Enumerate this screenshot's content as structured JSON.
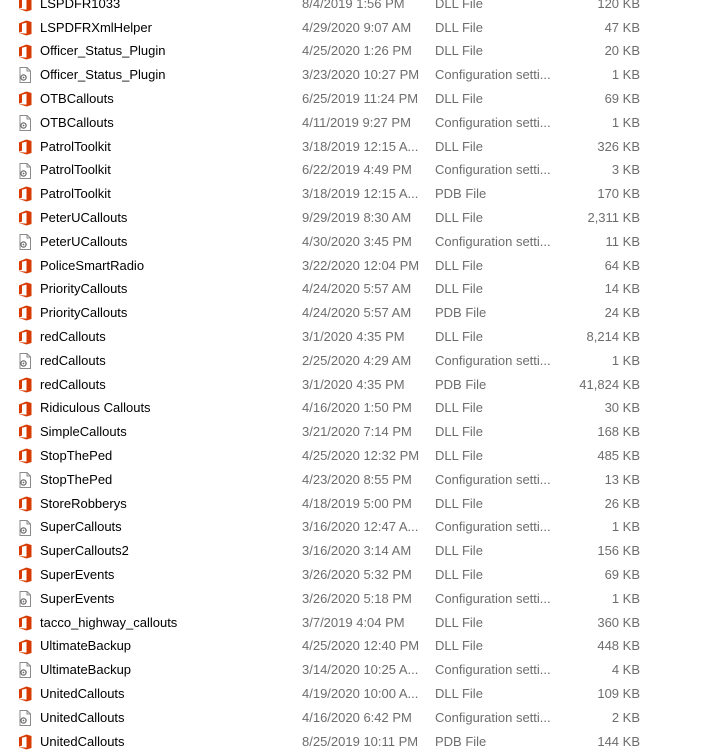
{
  "colors": {
    "office_icon": "#d83b01",
    "config_icon": "#8a8a8a",
    "meta_text": "#6d6d6d"
  },
  "files": [
    {
      "name": "LSPDFR1033",
      "date": "8/4/2019 1:56 PM",
      "type": "DLL File",
      "size": "120 KB",
      "icon": "office-icon"
    },
    {
      "name": "LSPDFRXmlHelper",
      "date": "4/29/2020 9:07 AM",
      "type": "DLL File",
      "size": "47 KB",
      "icon": "office-icon"
    },
    {
      "name": "Officer_Status_Plugin",
      "date": "4/25/2020 1:26 PM",
      "type": "DLL File",
      "size": "20 KB",
      "icon": "office-icon"
    },
    {
      "name": "Officer_Status_Plugin",
      "date": "3/23/2020 10:27 PM",
      "type": "Configuration setti...",
      "size": "1 KB",
      "icon": "config-file-icon"
    },
    {
      "name": "OTBCallouts",
      "date": "6/25/2019 11:24 PM",
      "type": "DLL File",
      "size": "69 KB",
      "icon": "office-icon"
    },
    {
      "name": "OTBCallouts",
      "date": "4/11/2019 9:27 PM",
      "type": "Configuration setti...",
      "size": "1 KB",
      "icon": "config-file-icon"
    },
    {
      "name": "PatrolToolkit",
      "date": "3/18/2019 12:15 A...",
      "type": "DLL File",
      "size": "326 KB",
      "icon": "office-icon"
    },
    {
      "name": "PatrolToolkit",
      "date": "6/22/2019 4:49 PM",
      "type": "Configuration setti...",
      "size": "3 KB",
      "icon": "config-file-icon"
    },
    {
      "name": "PatrolToolkit",
      "date": "3/18/2019 12:15 A...",
      "type": "PDB File",
      "size": "170 KB",
      "icon": "office-icon"
    },
    {
      "name": "PeterUCallouts",
      "date": "9/29/2019 8:30 AM",
      "type": "DLL File",
      "size": "2,311 KB",
      "icon": "office-icon"
    },
    {
      "name": "PeterUCallouts",
      "date": "4/30/2020 3:45 PM",
      "type": "Configuration setti...",
      "size": "11 KB",
      "icon": "config-file-icon"
    },
    {
      "name": "PoliceSmartRadio",
      "date": "3/22/2020 12:04 PM",
      "type": "DLL File",
      "size": "64 KB",
      "icon": "office-icon"
    },
    {
      "name": "PriorityCallouts",
      "date": "4/24/2020 5:57 AM",
      "type": "DLL File",
      "size": "14 KB",
      "icon": "office-icon"
    },
    {
      "name": "PriorityCallouts",
      "date": "4/24/2020 5:57 AM",
      "type": "PDB File",
      "size": "24 KB",
      "icon": "office-icon"
    },
    {
      "name": "redCallouts",
      "date": "3/1/2020 4:35 PM",
      "type": "DLL File",
      "size": "8,214 KB",
      "icon": "office-icon"
    },
    {
      "name": "redCallouts",
      "date": "2/25/2020 4:29 AM",
      "type": "Configuration setti...",
      "size": "1 KB",
      "icon": "config-file-icon"
    },
    {
      "name": "redCallouts",
      "date": "3/1/2020 4:35 PM",
      "type": "PDB File",
      "size": "41,824 KB",
      "icon": "office-icon"
    },
    {
      "name": "Ridiculous Callouts",
      "date": "4/16/2020 1:50 PM",
      "type": "DLL File",
      "size": "30 KB",
      "icon": "office-icon"
    },
    {
      "name": "SimpleCallouts",
      "date": "3/21/2020 7:14 PM",
      "type": "DLL File",
      "size": "168 KB",
      "icon": "office-icon"
    },
    {
      "name": "StopThePed",
      "date": "4/25/2020 12:32 PM",
      "type": "DLL File",
      "size": "485 KB",
      "icon": "office-icon"
    },
    {
      "name": "StopThePed",
      "date": "4/23/2020 8:55 PM",
      "type": "Configuration setti...",
      "size": "13 KB",
      "icon": "config-file-icon"
    },
    {
      "name": "StoreRobberys",
      "date": "4/18/2019 5:00 PM",
      "type": "DLL File",
      "size": "26 KB",
      "icon": "office-icon"
    },
    {
      "name": "SuperCallouts",
      "date": "3/16/2020 12:47 A...",
      "type": "Configuration setti...",
      "size": "1 KB",
      "icon": "config-file-icon"
    },
    {
      "name": "SuperCallouts2",
      "date": "3/16/2020 3:14 AM",
      "type": "DLL File",
      "size": "156 KB",
      "icon": "office-icon"
    },
    {
      "name": "SuperEvents",
      "date": "3/26/2020 5:32 PM",
      "type": "DLL File",
      "size": "69 KB",
      "icon": "office-icon"
    },
    {
      "name": "SuperEvents",
      "date": "3/26/2020 5:18 PM",
      "type": "Configuration setti...",
      "size": "1 KB",
      "icon": "config-file-icon"
    },
    {
      "name": "tacco_highway_callouts",
      "date": "3/7/2019 4:04 PM",
      "type": "DLL File",
      "size": "360 KB",
      "icon": "office-icon"
    },
    {
      "name": "UltimateBackup",
      "date": "4/25/2020 12:40 PM",
      "type": "DLL File",
      "size": "448 KB",
      "icon": "office-icon"
    },
    {
      "name": "UltimateBackup",
      "date": "3/14/2020 10:25 A...",
      "type": "Configuration setti...",
      "size": "4 KB",
      "icon": "config-file-icon"
    },
    {
      "name": "UnitedCallouts",
      "date": "4/19/2020 10:00 A...",
      "type": "DLL File",
      "size": "109 KB",
      "icon": "office-icon"
    },
    {
      "name": "UnitedCallouts",
      "date": "4/16/2020 6:42 PM",
      "type": "Configuration setti...",
      "size": "2 KB",
      "icon": "config-file-icon"
    },
    {
      "name": "UnitedCallouts",
      "date": "8/25/2019 10:11 PM",
      "type": "PDB File",
      "size": "144 KB",
      "icon": "office-icon"
    }
  ]
}
